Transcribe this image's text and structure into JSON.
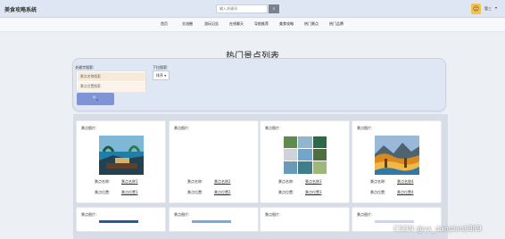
{
  "app": {
    "title": "美食攻略系统",
    "search_placeholder": "输入关键词",
    "search_icon": "magnifier-icon",
    "user_label": "管三",
    "avatar_icon": "avatar-icon"
  },
  "nav": [
    "首页",
    "交流圈",
    "游玩记告",
    "在线聊天",
    "导航推荐",
    "美食攻略",
    "热门景点",
    "热门品牌"
  ],
  "page": {
    "heading": "热门景点列表",
    "keyword_label": "关键字搜索:",
    "dropdown_label": "下拉搜索:",
    "keyword_placeholder": "景点名称搜索",
    "location_placeholder": "景点位置搜索",
    "sort_label": "排序",
    "search_button": "🔍"
  },
  "cards": [
    {
      "image_label": "景点图片:",
      "name_label": "景点名称:",
      "name_value": "景点名称1",
      "pos_label": "景点位置:",
      "pos_value": "景点位置1"
    },
    {
      "image_label": "景点图片:",
      "name_label": "景点名称:",
      "name_value": "景点名称2",
      "pos_label": "景点位置:",
      "pos_value": "景点位置2"
    },
    {
      "image_label": "景点图片:",
      "name_label": "景点名称:",
      "name_value": "景点名称3",
      "pos_label": "景点位置:",
      "pos_value": "景点位置3"
    },
    {
      "image_label": "景点图片:",
      "name_label": "景点名称:",
      "name_value": "景点名称4",
      "pos_label": "景点位置:",
      "pos_value": "景点位置4"
    }
  ],
  "bottom_cards": [
    {
      "image_label": "景点图片:"
    },
    {
      "image_label": "景点图片:"
    },
    {
      "image_label": "景点图片:"
    },
    {
      "image_label": "景点图片:"
    }
  ],
  "watermark": "CSDN @vx_danpianji889",
  "colors": {
    "topbar": "#dfe6f3",
    "panel": "#dfe6f4",
    "button": "#7f93d6"
  }
}
